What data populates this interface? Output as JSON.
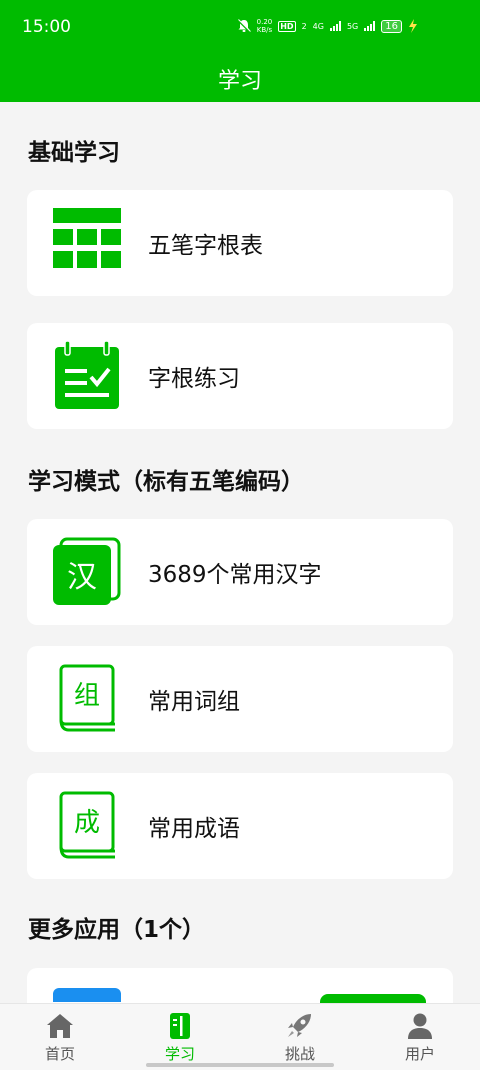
{
  "status": {
    "time": "15:00",
    "net_speed_value": "0.20",
    "net_speed_unit": "KB/s",
    "hd": "HD",
    "sim_index": "2",
    "net1": "4G",
    "net2": "5G",
    "battery": "16"
  },
  "app_bar": {
    "title": "学习"
  },
  "sections": {
    "basic": "基础学习",
    "mode": "学习模式（标有五笔编码）",
    "more": "更多应用（1个）"
  },
  "cards": {
    "wubi_table": "五笔字根表",
    "root_practice": "字根练习",
    "common_chars": "3689个常用汉字",
    "common_phrases": "常用词组",
    "common_idioms": "常用成语"
  },
  "icon_glyphs": {
    "han": "汉",
    "zu": "组",
    "cheng": "成"
  },
  "nav": {
    "home": "首页",
    "study": "学习",
    "challenge": "挑战",
    "user": "用户"
  },
  "colors": {
    "accent": "#00bb00",
    "background": "#f4f4f4"
  }
}
